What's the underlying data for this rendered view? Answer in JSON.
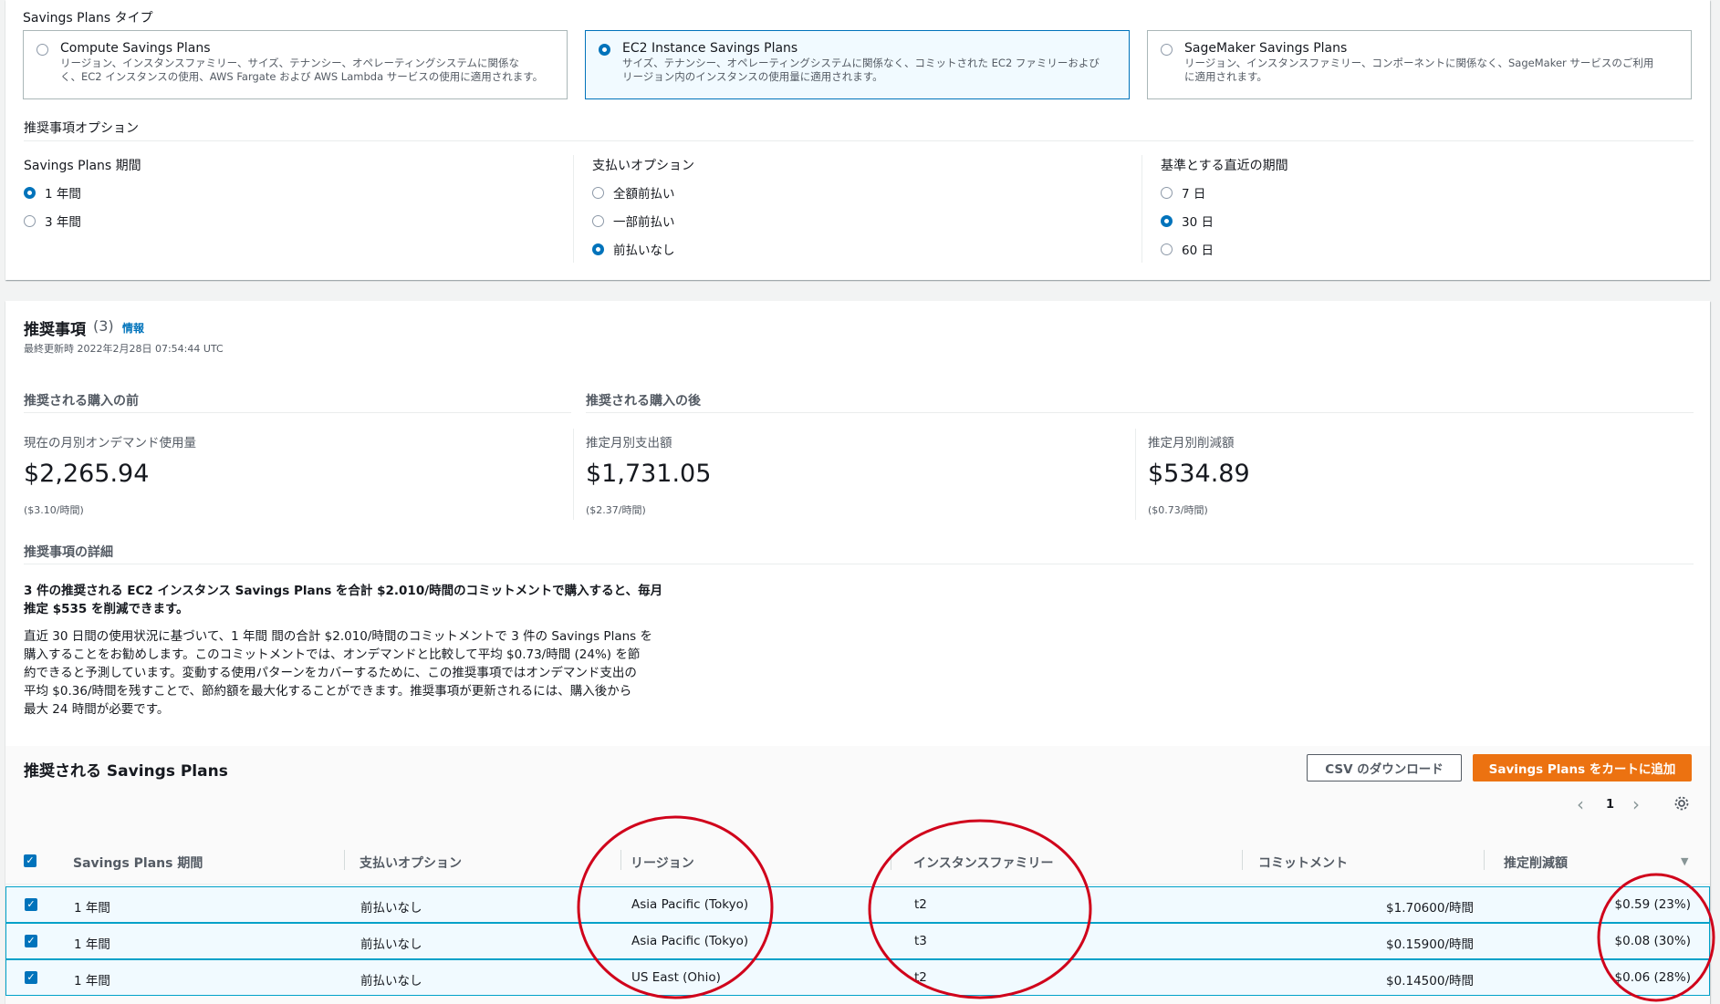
{
  "sp_type": {
    "label": "Savings Plans タイプ",
    "options": [
      {
        "title": "Compute Savings Plans",
        "desc1": "リージョン、インスタンスファミリー、サイズ、テナンシー、オペレーティングシステムに関係な",
        "desc2": "く、EC2 インスタンスの使用、AWS Fargate および AWS Lambda サービスの使用に適用されます。",
        "selected": false
      },
      {
        "title": "EC2 Instance Savings Plans",
        "desc1": "サイズ、テナンシー、オペレーティングシステムに関係なく、コミットされた EC2 ファミリーおよび",
        "desc2": "リージョン内のインスタンスの使用量に適用されます。",
        "selected": true
      },
      {
        "title": "SageMaker Savings Plans",
        "desc1": "リージョン、インスタンスファミリー、コンポーネントに関係なく、SageMaker サービスのご利用",
        "desc2": "に適用されます。",
        "selected": false
      }
    ]
  },
  "rec_options": {
    "heading": "推奨事項オプション",
    "term": {
      "label": "Savings Plans 期間",
      "opt1": "1 年間",
      "opt2": "3 年間"
    },
    "payment": {
      "label": "支払いオプション",
      "opt1": "全額前払い",
      "opt2": "一部前払い",
      "opt3": "前払いなし"
    },
    "lookback": {
      "label": "基準とする直近の期間",
      "opt1": "7 日",
      "opt2": "30 日",
      "opt3": "60 日"
    }
  },
  "recommendations": {
    "title": "推奨事項",
    "count": "(3)",
    "info": "情報",
    "updated": "最終更新時 2022年2月28日 07:54:44 UTC",
    "before_heading": "推奨される購入の前",
    "after_heading": "推奨される購入の後",
    "current": {
      "label": "現在の月別オンデマンド使用量",
      "value": "$2,265.94",
      "sub": "($3.10/時間)"
    },
    "est_spend": {
      "label": "推定月別支出額",
      "value": "$1,731.05",
      "sub": "($2.37/時間)"
    },
    "est_savings": {
      "label": "推定月別削減額",
      "value": "$534.89",
      "sub": "($0.73/時間)"
    },
    "details_heading": "推奨事項の詳細",
    "summary_line1": "3 件の推奨される EC2 インスタンス Savings Plans を合計 $2.010/時間のコミットメントで購入すると、毎月",
    "summary_line2": "推定 $535 を削減できます。",
    "body_lines": [
      "直近 30 日間の使用状況に基づいて、1 年間 間の合計 $2.010/時間のコミットメントで 3 件の Savings Plans を",
      "購入することをお勧めします。このコミットメントでは、オンデマンドと比較して平均 $0.73/時間 (24%) を節",
      "約できると予測しています。変動する使用パターンをカバーするために、この推奨事項ではオンデマンド支出の",
      "平均 $0.36/時間を残すことで、節約額を最大化することができます。推奨事項が更新されるには、購入後から",
      "最大 24 時間が必要です。"
    ]
  },
  "plans_table": {
    "title": "推奨される Savings Plans",
    "csv_button": "CSV のダウンロード",
    "add_button": "Savings Plans をカートに追加",
    "page": "1",
    "headers": [
      "Savings Plans 期間",
      "支払いオプション",
      "リージョン",
      "インスタンスファミリー",
      "コミットメント",
      "推定削減額"
    ],
    "rows": [
      {
        "term": "1 年間",
        "payment": "前払いなし",
        "region": "Asia Pacific (Tokyo)",
        "family": "t2",
        "commitment": "$1.70600/時間",
        "savings": "$0.59 (23%)"
      },
      {
        "term": "1 年間",
        "payment": "前払いなし",
        "region": "Asia Pacific (Tokyo)",
        "family": "t3",
        "commitment": "$0.15900/時間",
        "savings": "$0.08 (30%)"
      },
      {
        "term": "1 年間",
        "payment": "前払いなし",
        "region": "US East (Ohio)",
        "family": "t2",
        "commitment": "$0.14500/時間",
        "savings": "$0.06 (28%)"
      }
    ]
  },
  "colors": {
    "accent": "#0073bb",
    "primary_button": "#ec7211",
    "annotation": "#d0021b"
  }
}
